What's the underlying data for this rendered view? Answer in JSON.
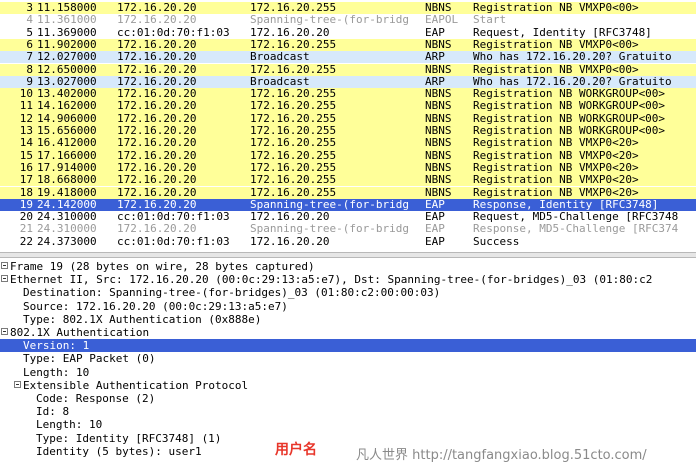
{
  "packets": [
    {
      "no": "3",
      "time": "11.158000",
      "source": "172.16.20.20",
      "destination": "172.16.20.255",
      "protocol": "NBNS",
      "info": "Registration NB VMXP0<00>",
      "style": "nbns"
    },
    {
      "no": "4",
      "time": "11.361000",
      "source": "172.16.20.20",
      "destination": "Spanning-tree-(for-bridg",
      "protocol": "EAPOL",
      "info": "Start",
      "style": "eapol"
    },
    {
      "no": "5",
      "time": "11.369000",
      "source": "cc:01:0d:70:f1:03",
      "destination": "172.16.20.20",
      "protocol": "EAP",
      "info": "Request, Identity [RFC3748]",
      "style": "eap"
    },
    {
      "no": "6",
      "time": "11.902000",
      "source": "172.16.20.20",
      "destination": "172.16.20.255",
      "protocol": "NBNS",
      "info": "Registration NB VMXP0<00>",
      "style": "nbns"
    },
    {
      "no": "7",
      "time": "12.027000",
      "source": "172.16.20.20",
      "destination": "Broadcast",
      "protocol": "ARP",
      "info": "Who has 172.16.20.20?  Gratuito",
      "style": "arp"
    },
    {
      "no": "8",
      "time": "12.650000",
      "source": "172.16.20.20",
      "destination": "172.16.20.255",
      "protocol": "NBNS",
      "info": "Registration NB VMXP0<00>",
      "style": "nbns"
    },
    {
      "no": "9",
      "time": "13.027000",
      "source": "172.16.20.20",
      "destination": "Broadcast",
      "protocol": "ARP",
      "info": "Who has 172.16.20.20?  Gratuito",
      "style": "arp"
    },
    {
      "no": "10",
      "time": "13.402000",
      "source": "172.16.20.20",
      "destination": "172.16.20.255",
      "protocol": "NBNS",
      "info": "Registration NB WORKGROUP<00>",
      "style": "nbns"
    },
    {
      "no": "11",
      "time": "14.162000",
      "source": "172.16.20.20",
      "destination": "172.16.20.255",
      "protocol": "NBNS",
      "info": "Registration NB WORKGROUP<00>",
      "style": "nbns"
    },
    {
      "no": "12",
      "time": "14.906000",
      "source": "172.16.20.20",
      "destination": "172.16.20.255",
      "protocol": "NBNS",
      "info": "Registration NB WORKGROUP<00>",
      "style": "nbns"
    },
    {
      "no": "13",
      "time": "15.656000",
      "source": "172.16.20.20",
      "destination": "172.16.20.255",
      "protocol": "NBNS",
      "info": "Registration NB WORKGROUP<00>",
      "style": "nbns"
    },
    {
      "no": "14",
      "time": "16.412000",
      "source": "172.16.20.20",
      "destination": "172.16.20.255",
      "protocol": "NBNS",
      "info": "Registration NB VMXP0<20>",
      "style": "nbns"
    },
    {
      "no": "15",
      "time": "17.166000",
      "source": "172.16.20.20",
      "destination": "172.16.20.255",
      "protocol": "NBNS",
      "info": "Registration NB VMXP0<20>",
      "style": "nbns"
    },
    {
      "no": "16",
      "time": "17.914000",
      "source": "172.16.20.20",
      "destination": "172.16.20.255",
      "protocol": "NBNS",
      "info": "Registration NB VMXP0<20>",
      "style": "nbns"
    },
    {
      "no": "17",
      "time": "18.668000",
      "source": "172.16.20.20",
      "destination": "172.16.20.255",
      "protocol": "NBNS",
      "info": "Registration NB VMXP0<20>",
      "style": "nbns"
    },
    {
      "no": "18",
      "time": "19.418000",
      "source": "172.16.20.20",
      "destination": "172.16.20.255",
      "protocol": "NBNS",
      "info": "Registration NB VMXP0<20>",
      "style": "nbns"
    },
    {
      "no": "19",
      "time": "24.142000",
      "source": "172.16.20.20",
      "destination": "Spanning-tree-(for-bridg",
      "protocol": "EAP",
      "info": "Response, Identity [RFC3748]",
      "style": "selected"
    },
    {
      "no": "20",
      "time": "24.310000",
      "source": "cc:01:0d:70:f1:03",
      "destination": "172.16.20.20",
      "protocol": "EAP",
      "info": "Request, MD5-Challenge [RFC3748",
      "style": "eap"
    },
    {
      "no": "21",
      "time": "24.310000",
      "source": "172.16.20.20",
      "destination": "Spanning-tree-(for-bridg",
      "protocol": "EAP",
      "info": "Response, MD5-Challenge [RFC374",
      "style": "eap-grey"
    },
    {
      "no": "22",
      "time": "24.373000",
      "source": "cc:01:0d:70:f1:03",
      "destination": "172.16.20.20",
      "protocol": "EAP",
      "info": "Success",
      "style": "eap"
    }
  ],
  "details": [
    {
      "text": "Frame 19 (28 bytes on wire, 28 bytes captured)",
      "level": 0,
      "toggle": true,
      "selected": false
    },
    {
      "text": "Ethernet II, Src: 172.16.20.20 (00:0c:29:13:a5:e7), Dst: Spanning-tree-(for-bridges)_03 (01:80:c2",
      "level": 0,
      "toggle": true,
      "selected": false
    },
    {
      "text": "Destination: Spanning-tree-(for-bridges)_03 (01:80:c2:00:00:03)",
      "level": 1,
      "toggle": false,
      "selected": false
    },
    {
      "text": "Source: 172.16.20.20 (00:0c:29:13:a5:e7)",
      "level": 1,
      "toggle": false,
      "selected": false
    },
    {
      "text": "Type: 802.1X Authentication (0x888e)",
      "level": 1,
      "toggle": false,
      "selected": false
    },
    {
      "text": "802.1X Authentication",
      "level": 0,
      "toggle": true,
      "selected": false
    },
    {
      "text": "Version: 1",
      "level": 1,
      "toggle": false,
      "selected": true
    },
    {
      "text": "Type: EAP Packet (0)",
      "level": 1,
      "toggle": false,
      "selected": false
    },
    {
      "text": "Length: 10",
      "level": 1,
      "toggle": false,
      "selected": false
    },
    {
      "text": "Extensible Authentication Protocol",
      "level": 1,
      "toggle": true,
      "selected": false
    },
    {
      "text": "Code: Response (2)",
      "level": 2,
      "toggle": false,
      "selected": false
    },
    {
      "text": "Id: 8",
      "level": 2,
      "toggle": false,
      "selected": false
    },
    {
      "text": "Length: 10",
      "level": 2,
      "toggle": false,
      "selected": false
    },
    {
      "text": "Type: Identity [RFC3748] (1)",
      "level": 2,
      "toggle": false,
      "selected": false
    },
    {
      "text": "Identity (5 bytes): user1",
      "level": 2,
      "toggle": false,
      "selected": false
    }
  ],
  "annotation": "用户名",
  "watermark": "凡人世界 http://tangfangxiao.blog.51cto.com/",
  "colors": {
    "nbns": "#ffff99",
    "arp": "#d7e9fb",
    "selected": "#3a5fd6",
    "annotation": "#e8362a"
  }
}
